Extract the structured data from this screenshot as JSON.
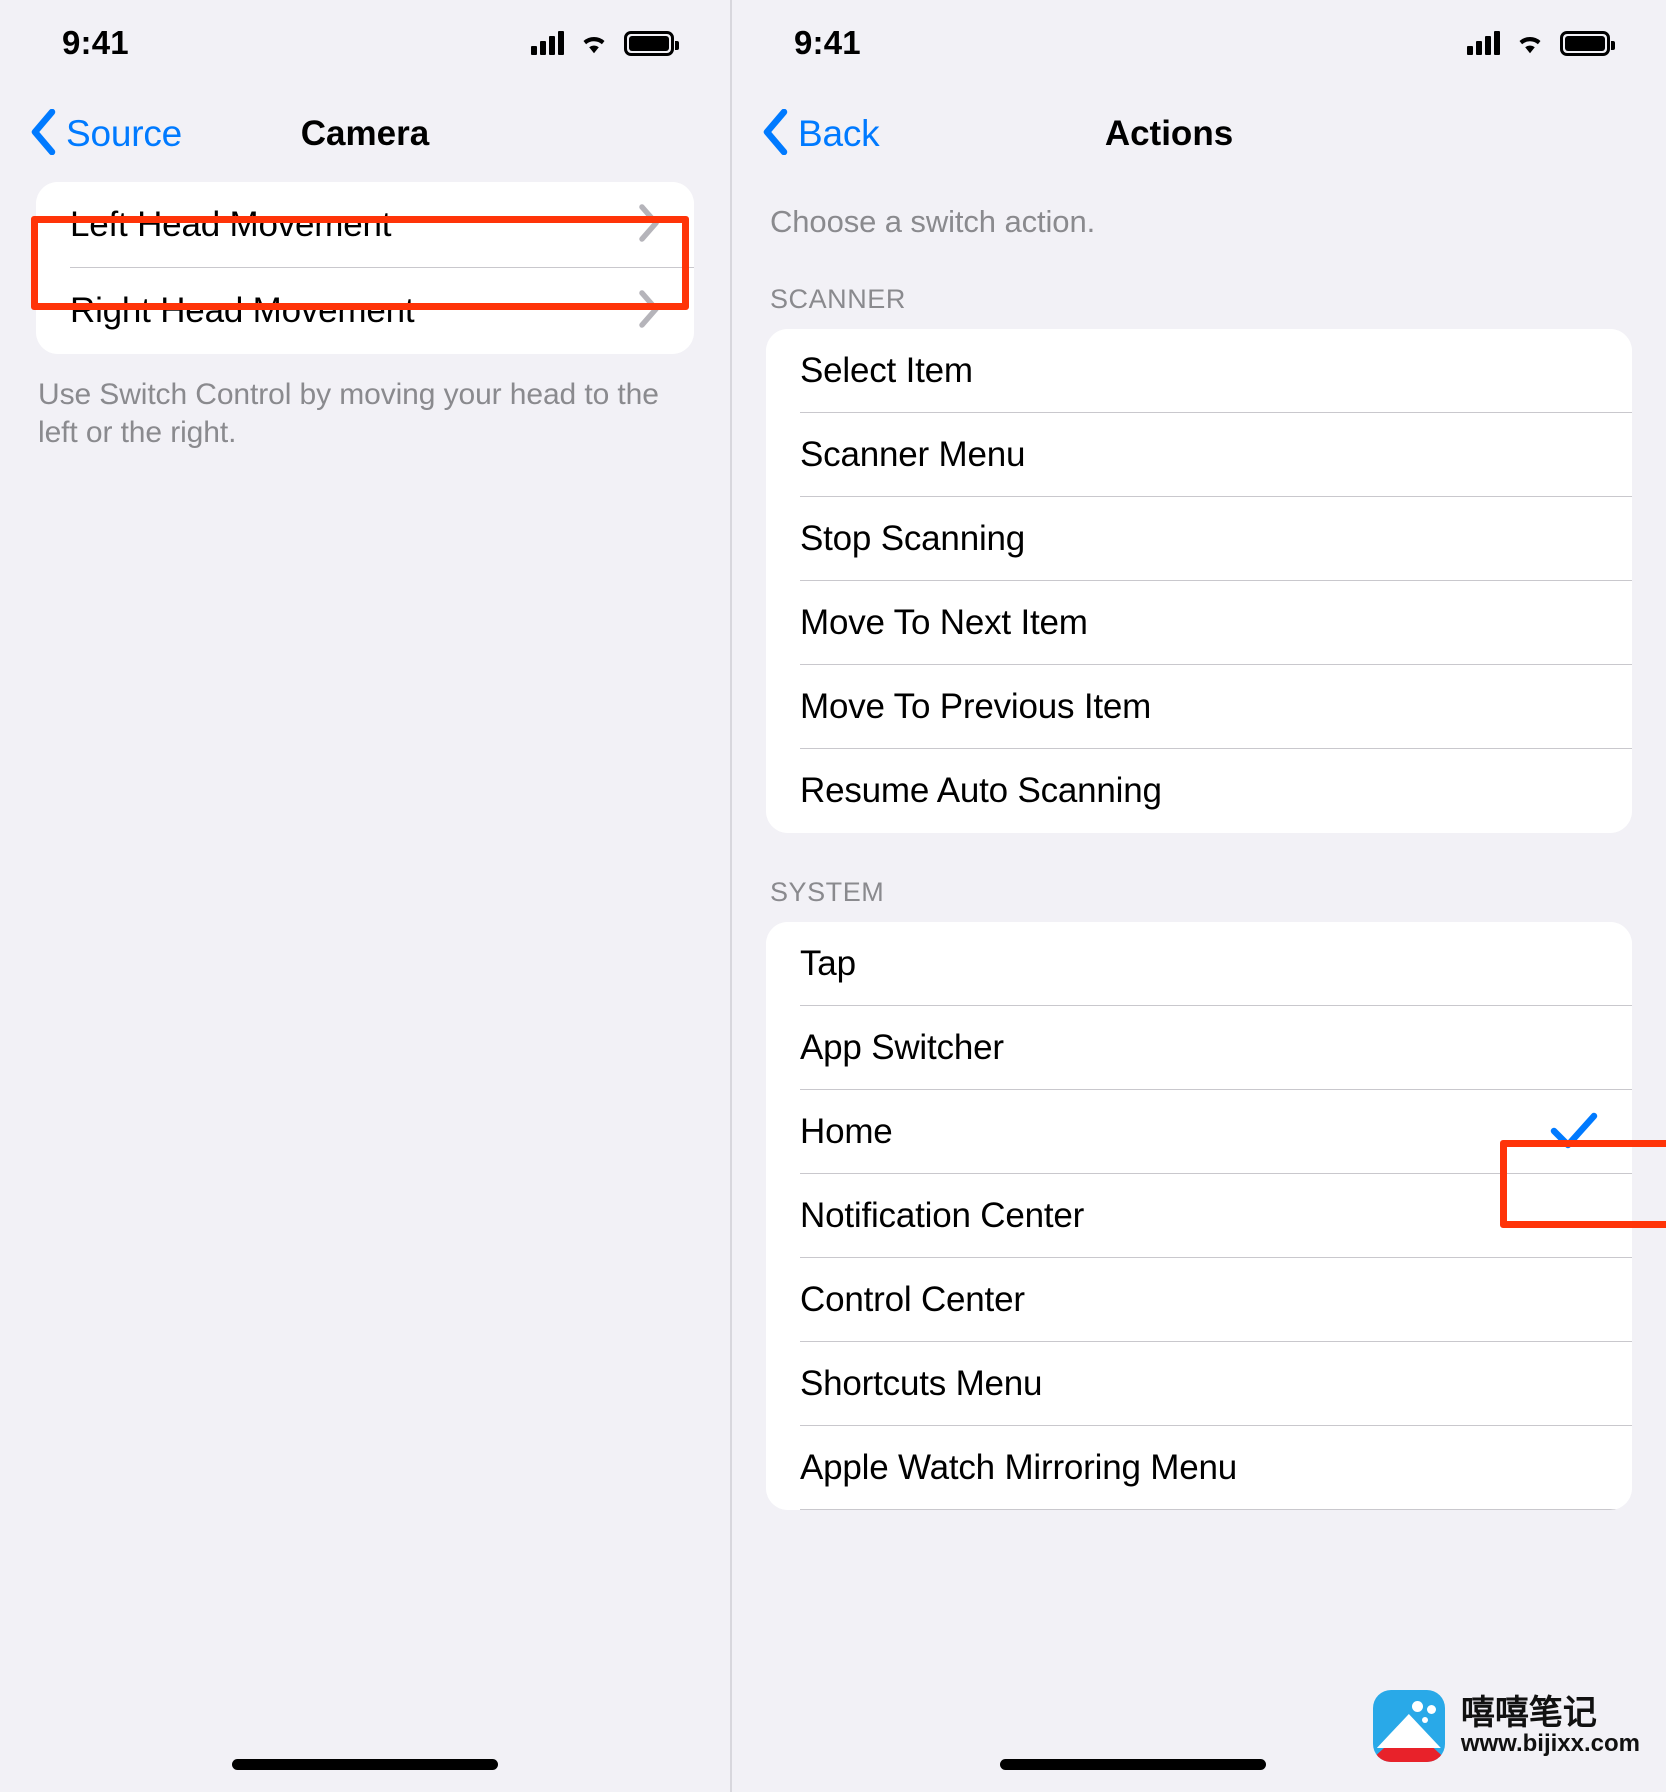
{
  "left_screen": {
    "status": {
      "time": "9:41",
      "cellular_icon": "cellular-bars-icon",
      "wifi_icon": "wifi-icon",
      "battery_icon": "battery-full-icon"
    },
    "nav": {
      "back_label": "Source",
      "title": "Camera",
      "back_icon": "chevron-left-icon"
    },
    "rows": [
      {
        "label": "Left Head Movement",
        "accessory": "chevron-right-icon",
        "highlighted": true
      },
      {
        "label": "Right Head Movement",
        "accessory": "chevron-right-icon",
        "highlighted": false
      }
    ],
    "footnote": "Use Switch Control by moving your head to the left or the right."
  },
  "right_screen": {
    "status": {
      "time": "9:41",
      "cellular_icon": "cellular-bars-icon",
      "wifi_icon": "wifi-icon",
      "battery_icon": "battery-full-icon"
    },
    "nav": {
      "back_label": "Back",
      "title": "Actions",
      "back_icon": "chevron-left-icon"
    },
    "intro": "Choose a switch action.",
    "sections": [
      {
        "header": "SCANNER",
        "rows": [
          {
            "label": "Select Item",
            "selected": false,
            "highlighted": false
          },
          {
            "label": "Scanner Menu",
            "selected": false,
            "highlighted": false
          },
          {
            "label": "Stop Scanning",
            "selected": false,
            "highlighted": false
          },
          {
            "label": "Move To Next Item",
            "selected": false,
            "highlighted": false
          },
          {
            "label": "Move To Previous Item",
            "selected": false,
            "highlighted": false
          },
          {
            "label": "Resume Auto Scanning",
            "selected": false,
            "highlighted": false
          }
        ]
      },
      {
        "header": "SYSTEM",
        "rows": [
          {
            "label": "Tap",
            "selected": false,
            "highlighted": false
          },
          {
            "label": "App Switcher",
            "selected": false,
            "highlighted": false
          },
          {
            "label": "Home",
            "selected": true,
            "highlighted": true
          },
          {
            "label": "Notification Center",
            "selected": false,
            "highlighted": false
          },
          {
            "label": "Control Center",
            "selected": false,
            "highlighted": false
          },
          {
            "label": "Shortcuts Menu",
            "selected": false,
            "highlighted": false
          },
          {
            "label": "Apple Watch Mirroring Menu",
            "selected": false,
            "highlighted": false
          }
        ]
      }
    ]
  },
  "watermark": {
    "brand": "嘻嘻笔记",
    "url": "www.bijixx.com",
    "logo_icon": "mountain-logo-icon"
  },
  "colors": {
    "accent_blue": "#007aff",
    "highlight_red": "#ff3408",
    "background": "#f2f1f6",
    "card": "#ffffff",
    "secondary_text": "#8a8a8e"
  }
}
